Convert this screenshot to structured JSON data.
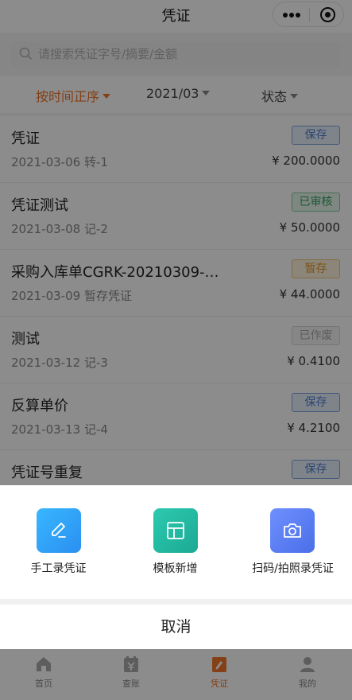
{
  "header": {
    "title": "凭证"
  },
  "search": {
    "placeholder": "请搜索凭证字号/摘要/金额"
  },
  "filters": [
    {
      "label": "按时间正序"
    },
    {
      "label": "2021/03"
    },
    {
      "label": "状态"
    }
  ],
  "vouchers": [
    {
      "title": "凭证",
      "date": "2021-03-06",
      "number": "转-1",
      "amount": "¥ 200.0000",
      "status": "保存"
    },
    {
      "title": "凭证测试",
      "date": "2021-03-08",
      "number": "记-2",
      "amount": "¥ 50.0000",
      "status": "已审核"
    },
    {
      "title": "采购入库单CGRK-20210309-…",
      "date": "2021-03-09",
      "number": "暂存凭证",
      "amount": "¥ 44.0000",
      "status": "暂存"
    },
    {
      "title": "测试",
      "date": "2021-03-12",
      "number": "记-3",
      "amount": "¥ 0.4100",
      "status": "已作废"
    },
    {
      "title": "反算单价",
      "date": "2021-03-13",
      "number": "记-4",
      "amount": "¥ 4.2100",
      "status": "保存"
    },
    {
      "title": "凭证号重复",
      "date": "",
      "number": "",
      "amount": "",
      "status": "保存"
    }
  ],
  "sheet": {
    "actions": [
      {
        "label": "手工录凭证",
        "icon": "edit-icon",
        "color": "#2f9ef5"
      },
      {
        "label": "模板新增",
        "icon": "template-icon",
        "color": "#22b9a3"
      },
      {
        "label": "扫码/拍照录凭证",
        "icon": "camera-icon",
        "color": "#5b7ff2"
      }
    ],
    "cancel_label": "取消"
  },
  "tabbar": [
    {
      "label": "首页",
      "icon": "home-icon"
    },
    {
      "label": "查账",
      "icon": "ledger-icon"
    },
    {
      "label": "凭证",
      "icon": "voucher-icon"
    },
    {
      "label": "我的",
      "icon": "profile-icon"
    }
  ],
  "colors": {
    "accent": "#f0752b",
    "status_saved": "#4f7fd1",
    "status_approved": "#35a063",
    "status_draft": "#e5951f",
    "status_void": "#a8a8a8"
  }
}
